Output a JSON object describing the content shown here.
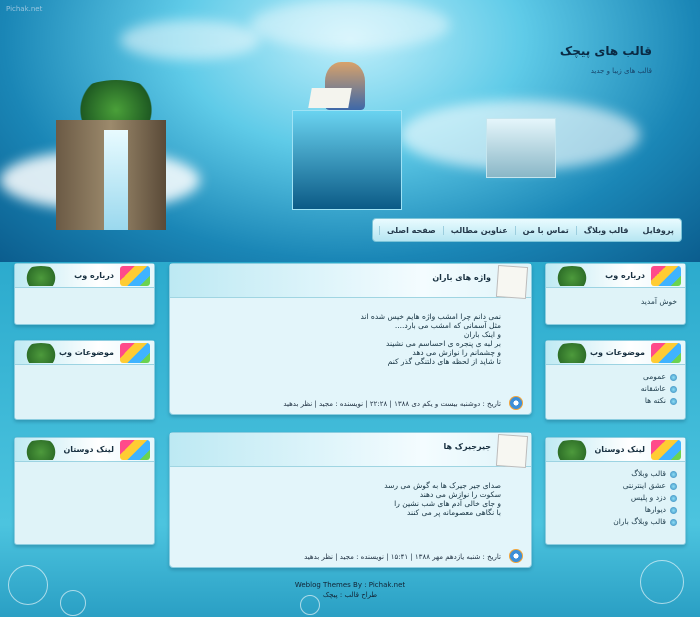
{
  "header": {
    "brand": "Pichak.net",
    "title": "قالب های پیچک",
    "subtitle": "قالب های زیبا و جدید"
  },
  "nav": [
    "صفحه اصلی",
    "عناوین مطالب",
    "تماس با من",
    "قالب وبلاگ",
    "پروفایل"
  ],
  "left": {
    "about": {
      "title": "درباره وب"
    },
    "topics": {
      "title": "موضوعات وب"
    },
    "friends": {
      "title": "لینک دوستان"
    }
  },
  "right": {
    "about": {
      "title": "درباره وب",
      "text": "خوش آمدید"
    },
    "topics": {
      "title": "موضوعات وب",
      "items": [
        "عمومی",
        "عاشقانه",
        "نکته ها"
      ]
    },
    "friends": {
      "title": "لینک دوستان",
      "items": [
        "قالب وبلاگ",
        "عشق اینترنتی",
        "دزد و پلیس",
        "دیوارها",
        "قالب وبلاگ باران"
      ]
    }
  },
  "posts": [
    {
      "title": "واژه های باران",
      "lines": [
        "نمی دانم چرا امشب واژه هایم خیس شده اند",
        "مثل آسمانی که امشب می بارد....",
        "و اینک باران",
        "بر لبه ی پنجره ی احساسم می نشیند",
        "و چشمانم را نوازش می دهد",
        "تا شاید از لحظه های دلتنگی گذر کنم"
      ],
      "meta": "تاریخ : دوشنبه بیست و یکم دی ۱۳۸۸ | ۲۲:۲۸ | نویسنده : مجید | نظر بدهید"
    },
    {
      "title": "جیرجیرک ها",
      "lines": [
        "صدای جیر جیرک ها به گوش می رسد",
        "سکوت را نوازش می دهند",
        "و جای خالی آدم های شب نشین را",
        "با نگاهی معصومانه پر می کنند"
      ],
      "meta": "تاریخ : شنبه یازدهم مهر ۱۳۸۸ | ۱۵:۴۱ | نویسنده : مجید | نظر بدهید"
    }
  ],
  "footer": {
    "line1": "Weblog Themes By : Pichak.net",
    "line2": "طراح قالب : پیچک"
  }
}
